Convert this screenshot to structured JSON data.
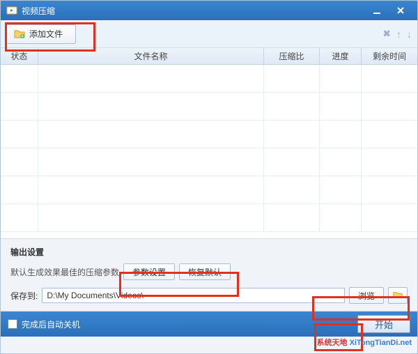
{
  "titlebar": {
    "title": "视频压缩"
  },
  "toolbar": {
    "add_file_label": "添加文件"
  },
  "table": {
    "headers": {
      "status": "状态",
      "name": "文件名称",
      "ratio": "压缩比",
      "progress": "进度",
      "time": "剩余时间"
    }
  },
  "settings": {
    "section_title": "输出设置",
    "param_label": "默认生成效果最佳的压缩参数",
    "param_settings_btn": "参数设置",
    "restore_default_btn": "恢复默认",
    "save_to_label": "保存到:",
    "save_path": "D:\\My Documents\\Videos\\",
    "browse_btn": "浏览"
  },
  "bottom": {
    "shutdown_label": "完成后自动关机",
    "start_btn": "开始"
  },
  "watermark": {
    "a": "系统天地",
    "b": "XiTongTianDi.net"
  }
}
